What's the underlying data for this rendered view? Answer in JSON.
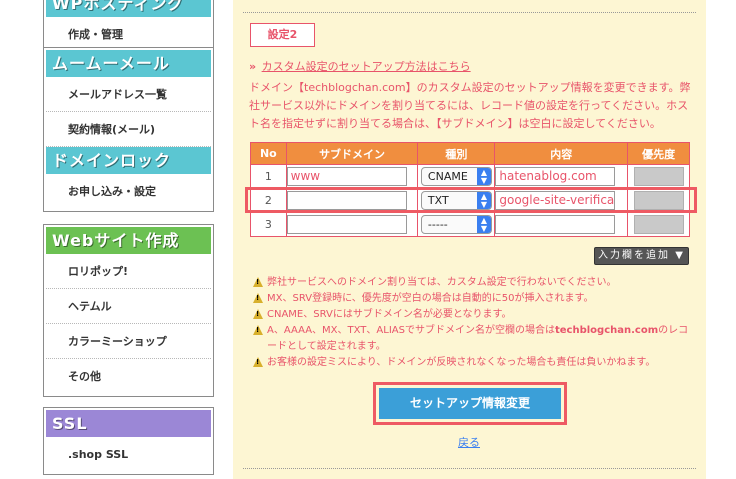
{
  "sidebar": {
    "wp_title": "WPホスティング",
    "wp_items": [
      "作成・管理"
    ],
    "mail_title": "ムームーメール",
    "mail_items": [
      "メールアドレス一覧",
      "契約情報(メール)"
    ],
    "domainlock_title": "ドメインロック",
    "domainlock_items": [
      "お申し込み・設定"
    ],
    "website_title": "Webサイト作成",
    "website_items": [
      "ロリポップ!",
      "ヘテムル",
      "カラーミーショップ",
      "その他"
    ],
    "ssl_title": "SSL",
    "ssl_items": [
      ".shop SSL"
    ]
  },
  "main": {
    "section_tag": "設定2",
    "setup_link": "カスタム設定のセットアップ方法はこちら",
    "description": "ドメイン【techblogchan.com】のカスタム設定のセットアップ情報を変更できます。弊社サービス以外にドメインを割り当てるには、レコード値の設定を行ってください。ホスト名を指定せずに割り当てる場合は、【サブドメイン】は空白に設定してください。",
    "table": {
      "headers": [
        "No",
        "サブドメイン",
        "種別",
        "内容",
        "優先度"
      ],
      "rows": [
        {
          "no": "1",
          "subdomain": "www",
          "type": "CNAME",
          "content": "hatenablog.com"
        },
        {
          "no": "2",
          "subdomain": "",
          "type": "TXT",
          "content": "google-site-verificat"
        },
        {
          "no": "3",
          "subdomain": "",
          "type": "-----",
          "content": ""
        }
      ]
    },
    "add_row_button": "入力欄を追加",
    "notes": {
      "n1": "弊社サービスへのドメイン割り当ては、カスタム設定で行わないでください。",
      "n2": "MX、SRV登録時に、優先度が空白の場合は自動的に50が挿入されます。",
      "n3": "CNAME、SRVにはサブドメイン名が必要となります。",
      "n4a": "A、AAAA、MX、TXT、ALIASでサブドメイン名が空欄の場合は",
      "n4b": "techblogchan.com",
      "n4c": "のレコードとして設定されます。",
      "n5": "お客様の設定ミスにより、ドメインが反映されなくなった場合も責任は負いかねます。"
    },
    "submit_button": "セットアップ情報変更",
    "back_link": "戻る"
  }
}
